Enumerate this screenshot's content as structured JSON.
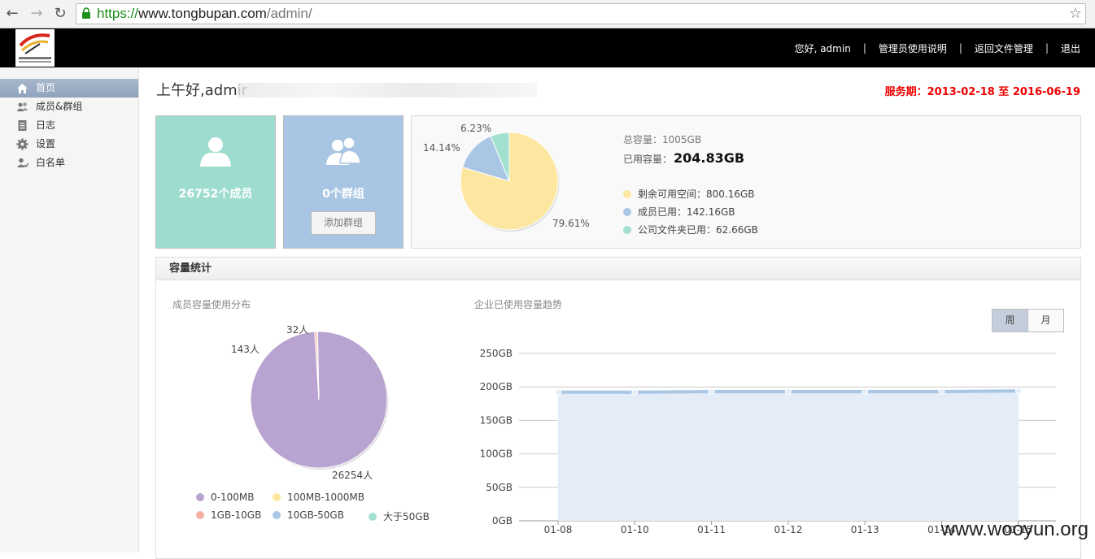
{
  "browser": {
    "url_https": "https://",
    "url_host": "www.tongbupan.com",
    "url_path": "/admin/"
  },
  "header": {
    "greeting_user": "您好, admin",
    "links": [
      "管理员使用说明",
      "返回文件管理",
      "退出"
    ]
  },
  "sidebar": {
    "items": [
      {
        "label": "首页",
        "icon": "home-icon",
        "active": true
      },
      {
        "label": "成员&群组",
        "icon": "users-icon",
        "active": false
      },
      {
        "label": "日志",
        "icon": "log-icon",
        "active": false
      },
      {
        "label": "设置",
        "icon": "gear-icon",
        "active": false
      },
      {
        "label": "白名单",
        "icon": "whitelist-icon",
        "active": false
      }
    ]
  },
  "main": {
    "greeting": "上午好,admir",
    "service_period": "服务期：2013-02-18 至 2016-06-19"
  },
  "cards": {
    "members": {
      "count_label": "26752个成员"
    },
    "groups": {
      "count_label": "0个群组",
      "add_button": "添加群组"
    }
  },
  "storage": {
    "total_label": "总容量：1005GB",
    "used_label": "已用容量：",
    "used_value": "204.83GB",
    "legend": [
      {
        "label": "剩余可用空间：800.16GB",
        "color": "#fde7a0"
      },
      {
        "label": "成员已用：142.16GB",
        "color": "#a9c7e5"
      },
      {
        "label": "公司文件夹已用：62.66GB",
        "color": "#a2e0cf"
      }
    ],
    "percent_labels": [
      "79.61%",
      "14.14%",
      "6.23%"
    ]
  },
  "panel": {
    "title": "容量统计",
    "left_title": "成员容量使用分布",
    "right_title": "企业已使用容量趋势",
    "toggle_week": "周",
    "toggle_month": "月"
  },
  "member_pie": {
    "slice_labels": [
      "26254人",
      "143人",
      "32人"
    ],
    "legend": [
      {
        "label": "0-100MB",
        "color": "#b9a3d0"
      },
      {
        "label": "100MB-1000MB",
        "color": "#fde7a0"
      },
      {
        "label": "1GB-10GB",
        "color": "#f6b1a5"
      },
      {
        "label": "10GB-50GB",
        "color": "#a9c7e5"
      },
      {
        "label": "大于50GB",
        "color": "#a2e0cf"
      }
    ]
  },
  "chart_data": [
    {
      "type": "pie",
      "title": "",
      "labels": [
        "剩余可用空间",
        "成员已用",
        "公司文件夹已用"
      ],
      "values": [
        800.16,
        142.16,
        62.66
      ],
      "percent_labels": [
        "79.61%",
        "14.14%",
        "6.23%"
      ],
      "colors": [
        "#fde7a0",
        "#a9c7e5",
        "#a2e0cf"
      ]
    },
    {
      "type": "pie",
      "title": "成员容量使用分布",
      "labels": [
        "0-100MB",
        "100MB-1000MB",
        "1GB-10GB",
        "10GB-50GB",
        "大于50GB"
      ],
      "values": [
        26254,
        32,
        143,
        0,
        0
      ],
      "colors": [
        "#b9a3d0",
        "#fde7a0",
        "#f6b1a5",
        "#a9c7e5",
        "#a2e0cf"
      ],
      "legend": "bottom"
    },
    {
      "type": "area",
      "title": "企业已使用容量趋势",
      "x": [
        "01-08",
        "01-10",
        "01-11",
        "01-12",
        "01-13",
        "01-14",
        "01-15"
      ],
      "x_tick_labels": [
        "01-08",
        "01-10",
        "01-11",
        "01-12",
        "01-13",
        "01-14",
        "01-15"
      ],
      "y": [
        192,
        192,
        193,
        193,
        193,
        193,
        194
      ],
      "y_ticks": [
        "0GB",
        "50GB",
        "100GB",
        "150GB",
        "200GB",
        "250GB"
      ],
      "ylim": [
        0,
        250
      ],
      "grid": true
    }
  ],
  "watermark": "www.wooyun.org"
}
